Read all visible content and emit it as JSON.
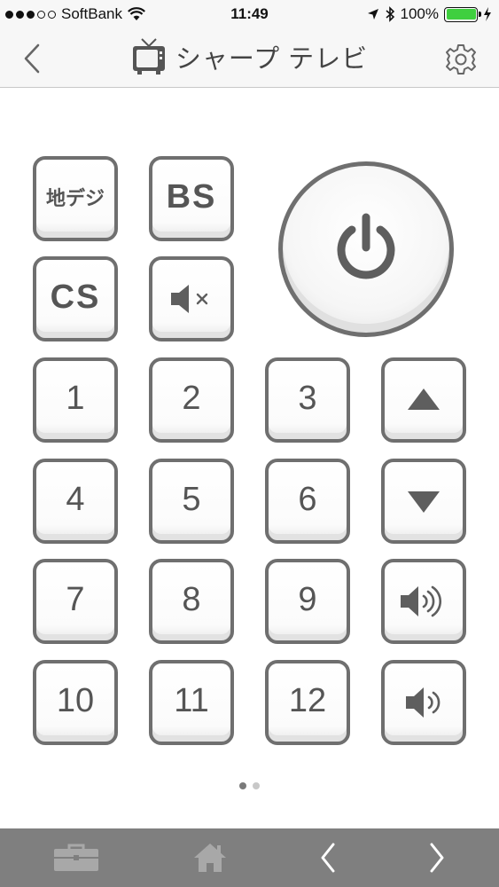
{
  "status_bar": {
    "carrier": "SoftBank",
    "time": "11:49",
    "battery": "100%"
  },
  "nav": {
    "title": "シャープ テレビ"
  },
  "remote": {
    "keys": {
      "chideji": "地デジ",
      "bs": "BS",
      "cs": "CS",
      "ch1": "1",
      "ch2": "2",
      "ch3": "3",
      "ch4": "4",
      "ch5": "5",
      "ch6": "6",
      "ch7": "7",
      "ch8": "8",
      "ch9": "9",
      "ch10": "10",
      "ch11": "11",
      "ch12": "12"
    },
    "icons": {
      "mute": "mute-icon",
      "power": "power-icon",
      "channel_up": "triangle-up-icon",
      "channel_down": "triangle-down-icon",
      "volume_up": "volume-up-icon",
      "volume_down": "volume-down-icon"
    }
  },
  "pager": {
    "current_page": 1,
    "total_pages": 2
  },
  "toolbar": {
    "icons": [
      "toolbox-icon",
      "home-icon",
      "chevron-left-icon",
      "chevron-right-icon"
    ]
  },
  "colors": {
    "button_border": "#6f6f6f",
    "toolbar_bg": "#7f7f7f",
    "battery": "#3fcf3f"
  }
}
